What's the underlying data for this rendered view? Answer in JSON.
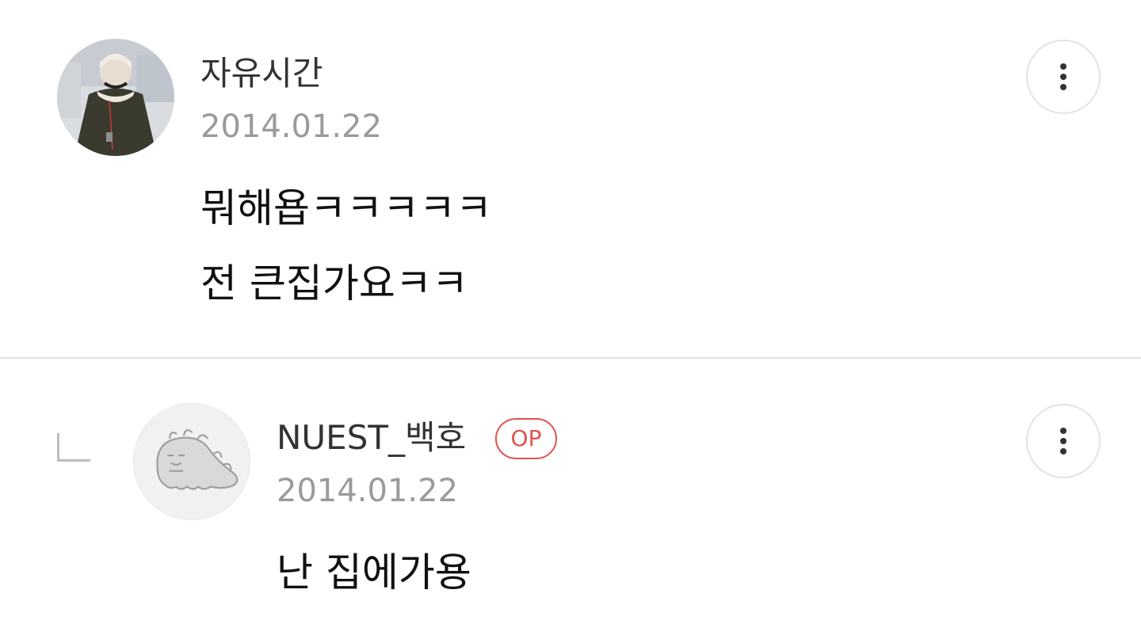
{
  "comments": [
    {
      "author": "자유시간",
      "date": "2014.01.22",
      "lines": [
        "뭐해욥ㅋㅋㅋㅋㅋ",
        "전 큰집가요ㅋㅋ"
      ]
    },
    {
      "author": "NUEST_백호",
      "badge": "OP",
      "date": "2014.01.22",
      "lines": [
        "난 집에가용"
      ]
    }
  ],
  "colors": {
    "badge": "#e0524e",
    "divider": "#e2e2e2",
    "date": "#9a9a9a"
  },
  "icons": {
    "more": "more-vertical-icon",
    "reply": "reply-indent-icon"
  }
}
